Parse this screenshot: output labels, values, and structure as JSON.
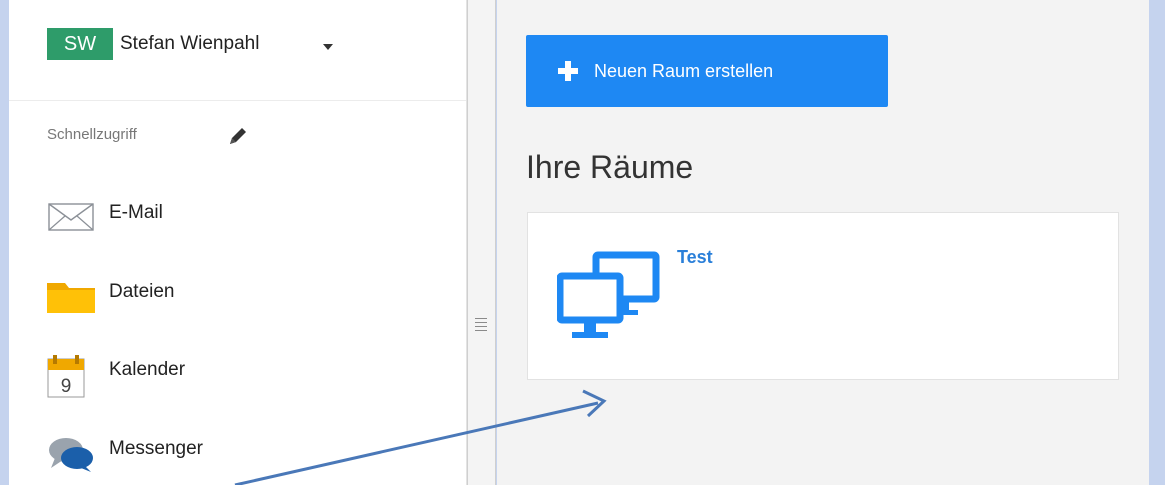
{
  "user": {
    "initials": "SW",
    "name": "Stefan Wienpahl"
  },
  "sidebar": {
    "quick_access_label": "Schnellzugriff",
    "items": [
      {
        "label": "E-Mail",
        "icon": "mail-icon"
      },
      {
        "label": "Dateien",
        "icon": "folder-icon"
      },
      {
        "label": "Kalender",
        "icon": "calendar-icon",
        "calendar_day": "9"
      },
      {
        "label": "Messenger",
        "icon": "messenger-icon"
      }
    ]
  },
  "main": {
    "create_button_label": "Neuen Raum erstellen",
    "section_title": "Ihre Räume",
    "rooms": [
      {
        "name": "Test",
        "icon": "monitors-icon"
      }
    ]
  },
  "colors": {
    "accent": "#1e88f3",
    "avatar": "#2e9c6a",
    "room_link": "#2a7fd9",
    "annotation_arrow": "#4a78b8",
    "backdrop": "#c5d3ee"
  }
}
